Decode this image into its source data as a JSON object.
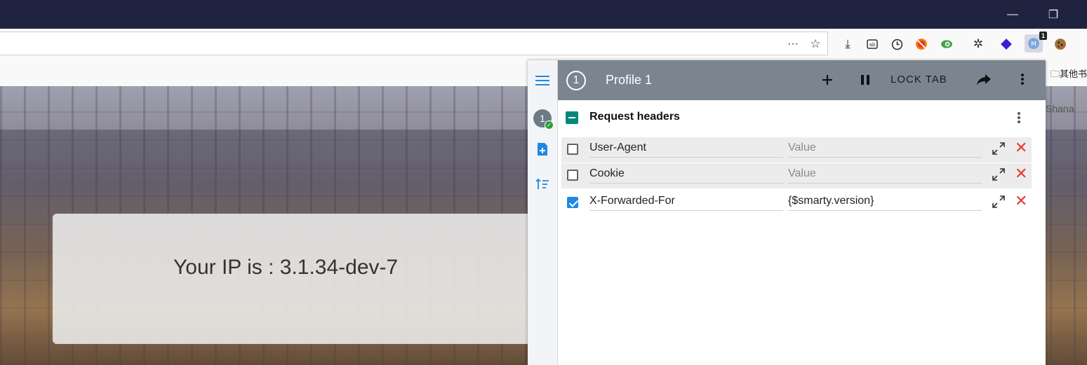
{
  "window": {
    "minimize_glyph": "—",
    "restore_glyph": "❐"
  },
  "toolbar": {
    "icons": [
      "more-icon",
      "star-icon",
      "download-icon",
      "reader-icon",
      "clock-icon",
      "blocker-icon",
      "extension-green-icon",
      "gear-icon",
      "diamond-icon",
      "modheader-icon",
      "cookie-icon"
    ],
    "extension_badge": "1"
  },
  "bookmarks": {
    "other_label": "其他书"
  },
  "page": {
    "ip_text": "Your IP is : 3.1.34-dev-7",
    "corner_text": "Shana"
  },
  "popup": {
    "profile_number": "1",
    "profile_name": "Profile 1",
    "lock_tab_label": "LOCK TAB",
    "section_title": "Request headers",
    "accent_color": "#1e88e5",
    "header_bg": "#7b8590",
    "rows": [
      {
        "checked": false,
        "name": "User-Agent",
        "value": "",
        "placeholder": "Value"
      },
      {
        "checked": false,
        "name": "Cookie",
        "value": "",
        "placeholder": "Value"
      },
      {
        "checked": true,
        "name": "X-Forwarded-For",
        "value": "{$smarty.version}",
        "placeholder": "Value"
      }
    ]
  }
}
